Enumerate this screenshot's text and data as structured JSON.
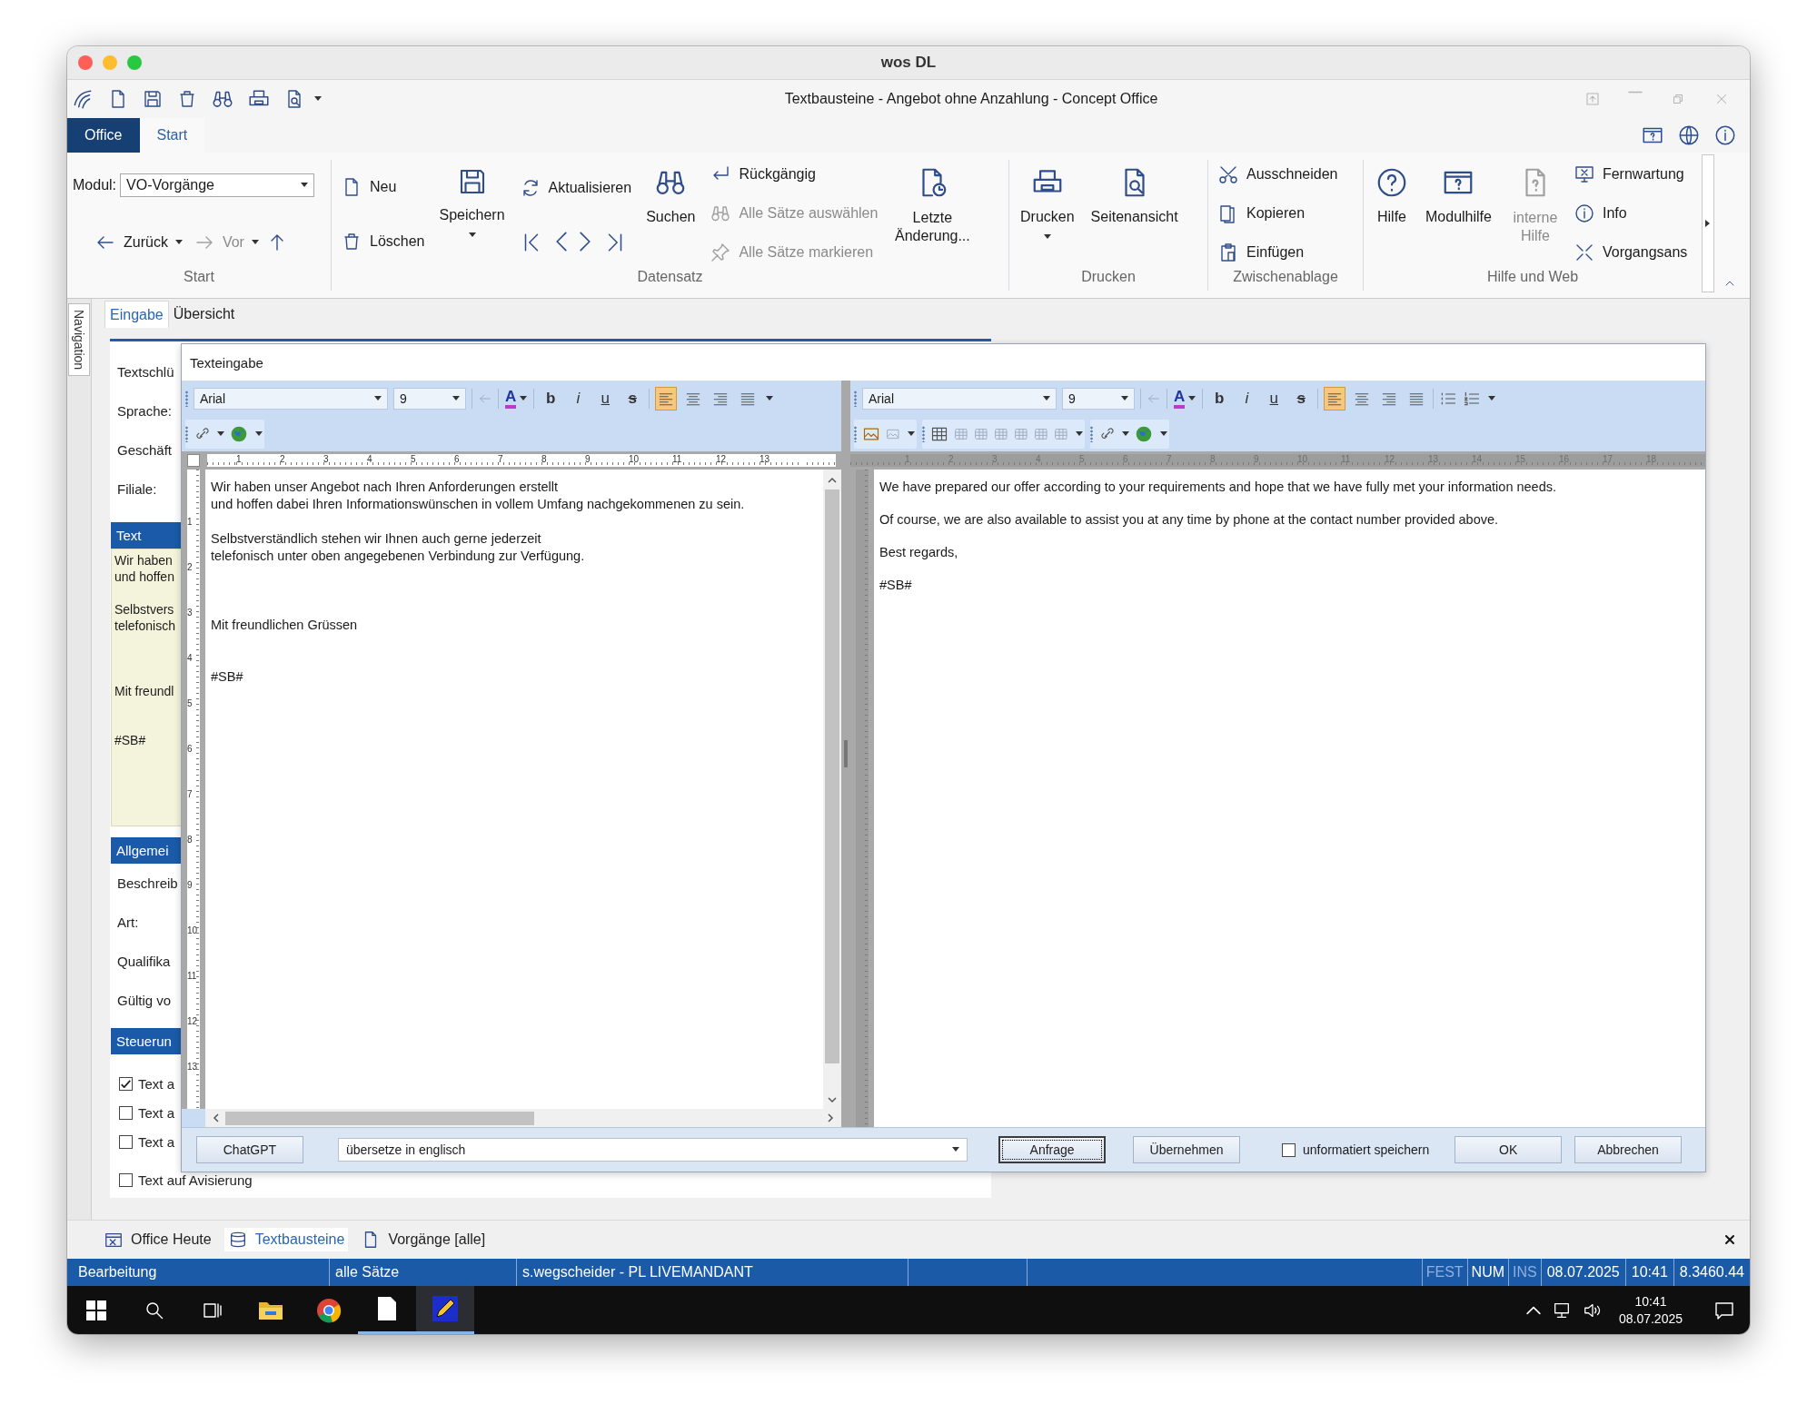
{
  "window": {
    "title": "wos DL"
  },
  "app_title": "Textbausteine - Angebot ohne Anzahlung - Concept Office",
  "ribbon_tabs": [
    {
      "label": "Office",
      "selected": true
    },
    {
      "label": "Start",
      "selected": false
    }
  ],
  "ribbon": {
    "start_group": {
      "title": "Start",
      "module_label": "Modul:",
      "module_value": "VO-Vorgänge",
      "back": "Zurück",
      "forward": {
        "label": "Vor",
        "disabled": true
      }
    },
    "record_group": {
      "title": "Datensatz",
      "new": "Neu",
      "delete": "Löschen",
      "save": "Speichern",
      "refresh": "Aktualisieren",
      "search": "Suchen",
      "undo": "Rückgängig",
      "select_all": {
        "label": "Alle Sätze auswählen",
        "disabled": true
      },
      "mark_all": {
        "label": "Alle Sätze markieren",
        "disabled": true
      },
      "last_change": "Letzte Änderung..."
    },
    "print_group": {
      "title": "Drucken",
      "print": "Drucken",
      "preview": "Seitenansicht"
    },
    "clipboard_group": {
      "title": "Zwischenablage",
      "cut": "Ausschneiden",
      "copy": "Kopieren",
      "paste": "Einfügen"
    },
    "help_group": {
      "title": "Hilfe und Web",
      "help": "Hilfe",
      "module_help": "Modulhilfe",
      "internal_help": {
        "label": "interne Hilfe",
        "disabled": true
      },
      "remote": "Fernwartung",
      "info": "Info",
      "process_view": "Vorgangsans"
    }
  },
  "navigation_tab": "Navigation",
  "form": {
    "tabs": [
      {
        "label": "Eingabe",
        "selected": true
      },
      {
        "label": "Übersicht",
        "selected": false
      }
    ],
    "fields": [
      "Textschlü",
      "Sprache:",
      "Geschäft",
      "Filiale:"
    ],
    "text_section": {
      "title": "Text",
      "paragraphs": [
        [
          "Wir haben",
          "und hoffen"
        ],
        [
          "Selbstvers",
          "telefonisch"
        ],
        [
          "Mit freundl"
        ],
        [
          "#SB#"
        ]
      ]
    },
    "general_section": {
      "title": "Allgemei",
      "fields": [
        "Beschreib",
        "Art:",
        "Qualifika",
        "Gültig vo"
      ]
    },
    "control_section": {
      "title": "Steuerun",
      "options": [
        {
          "label": "Text a",
          "checked": true
        },
        {
          "label": "Text a",
          "checked": false
        },
        {
          "label": "Text a",
          "checked": false
        },
        {
          "label": "Text auf Avisierung",
          "checked": false
        }
      ]
    }
  },
  "dialog": {
    "title": "Texteingabe",
    "panes": [
      {
        "kind": "source",
        "font": "Arial",
        "size": "9",
        "color_button": "A",
        "format_buttons": [
          {
            "kind": "bold",
            "label": "b"
          },
          {
            "kind": "italic",
            "label": "i"
          },
          {
            "kind": "underline",
            "label": "u"
          },
          {
            "kind": "strike",
            "label": "s"
          }
        ],
        "align_buttons": [
          {
            "kind": "left",
            "selected": true
          },
          {
            "kind": "center",
            "selected": false
          },
          {
            "kind": "right",
            "selected": false
          },
          {
            "kind": "justify",
            "selected": false
          }
        ],
        "ruler": [
          "1",
          "2",
          "3",
          "4",
          "5",
          "6",
          "7",
          "8",
          "9",
          "10",
          "11",
          "12",
          "13"
        ],
        "vertical_ruler": [
          "1",
          "2",
          "3",
          "4",
          "5",
          "6",
          "7",
          "8",
          "9",
          "10",
          "11",
          "12",
          "13"
        ],
        "paragraphs": [
          [
            "Wir haben unser Angebot nach Ihren Anforderungen erstellt",
            "und hoffen dabei Ihren Informationswünschen in vollem Umfang nachgekommenen zu sein."
          ],
          [
            "Selbstverständlich stehen wir Ihnen auch gerne jederzeit",
            "telefonisch unter oben angegebenen Verbindung zur Verfügung."
          ],
          [
            "Mit freundlichen Grüssen"
          ],
          [
            "#SB#"
          ]
        ]
      },
      {
        "kind": "translation",
        "font": "Arial",
        "size": "9",
        "color_button": "A",
        "format_buttons": [
          {
            "kind": "bold",
            "label": "b"
          },
          {
            "kind": "italic",
            "label": "i"
          },
          {
            "kind": "underline",
            "label": "u"
          },
          {
            "kind": "strike",
            "label": "s"
          }
        ],
        "align_buttons": [
          {
            "kind": "left",
            "selected": true
          },
          {
            "kind": "center",
            "selected": false
          },
          {
            "kind": "right",
            "selected": false
          },
          {
            "kind": "justify",
            "selected": false
          }
        ],
        "ruler": [
          "1",
          "2",
          "3",
          "4",
          "5",
          "6",
          "7",
          "8",
          "9",
          "10",
          "11",
          "12",
          "13",
          "14",
          "15",
          "16",
          "17",
          "18"
        ],
        "paragraphs": [
          [
            "We have prepared our offer according to your requirements and hope that we have fully met your information needs."
          ],
          [
            "Of course, we are also available to assist you at any time by phone at the contact number provided above."
          ],
          [
            "Best regards,"
          ],
          [
            "#SB#"
          ]
        ]
      }
    ],
    "bottom_bar": {
      "chatgpt": "ChatGPT",
      "prompt": "übersetze in englisch",
      "request": "Anfrage",
      "apply": "Übernehmen",
      "unformatted": {
        "label": "unformatiert speichern",
        "checked": false
      },
      "ok": "OK",
      "cancel": "Abbrechen"
    }
  },
  "doc_tabs": [
    {
      "label": "Office Heute",
      "selected": false
    },
    {
      "label": "Textbausteine",
      "selected": true
    },
    {
      "label": "Vorgänge [alle]",
      "selected": false
    }
  ],
  "status_bar": {
    "cells": [
      "Bearbeitung",
      "alle Sätze",
      "s.wegscheider - PL LIVEMANDANT"
    ],
    "indicators": [
      {
        "label": "FEST",
        "on": false
      },
      {
        "label": "NUM",
        "on": true
      },
      {
        "label": "INS",
        "on": false
      }
    ],
    "date": "08.07.2025",
    "time": "10:41",
    "version": "8.3460.44"
  },
  "taskbar": {
    "apps": [
      {
        "kind": "explorer",
        "open": false,
        "selected": false
      },
      {
        "kind": "chrome",
        "open": false,
        "selected": false
      },
      {
        "kind": "document",
        "open": true,
        "selected": false
      },
      {
        "kind": "pencil",
        "open": true,
        "selected": true
      }
    ],
    "time": "10:41",
    "date": "08.07.2025"
  }
}
